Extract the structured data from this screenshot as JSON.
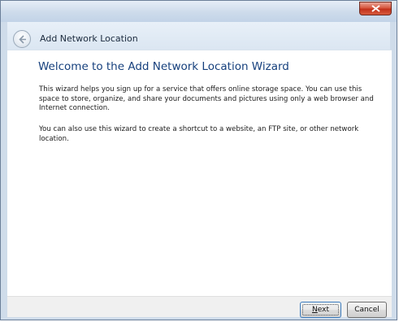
{
  "window": {
    "title": "Add Network Location",
    "close_icon": "close-icon",
    "back_icon": "back-arrow-icon"
  },
  "content": {
    "heading": "Welcome to the Add Network Location Wizard",
    "paragraph1": "This wizard helps you sign up for a service that offers online storage space. You can use this space to store, organize, and share your documents and pictures using only a web browser and Internet connection.",
    "paragraph2": "You can also use this wizard to create a shortcut to a website, an FTP site, or other network location."
  },
  "footer": {
    "next_label": "Next",
    "cancel_label": "Cancel"
  },
  "colors": {
    "heading": "#16407d",
    "chrome": "#cfdcea"
  }
}
